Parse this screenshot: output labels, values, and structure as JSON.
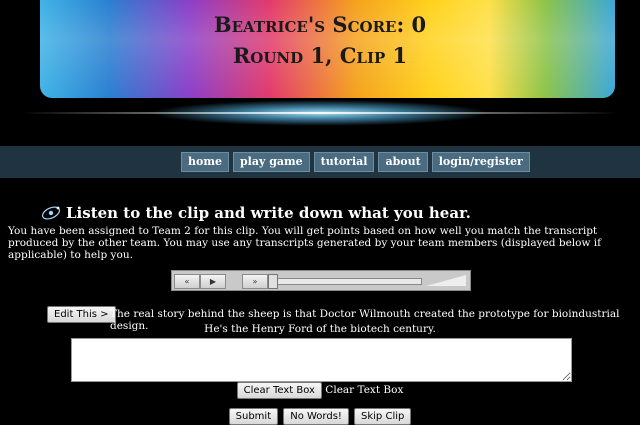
{
  "header": {
    "score_text": "Beatrice's Score: 0",
    "round_text": "Round 1, Clip 1"
  },
  "nav": {
    "items": [
      "home",
      "play game",
      "tutorial",
      "about",
      "login/register"
    ]
  },
  "instructions": {
    "heading": "Listen to the clip and write down what you hear.",
    "body": "You have been assigned to Team 2 for this clip. You will get points based on how well you match the transcript produced by the other team. You may use any transcripts generated by your team members (displayed below if applicable) to help you."
  },
  "player": {
    "rewind_label": "«",
    "play_label": "▶",
    "forward_label": "»"
  },
  "transcript": {
    "edit_label": "Edit This >",
    "line1": "The real story behind the sheep is that Doctor Wilmouth created the prototype for bioindustrial design.",
    "line2": "He's the Henry Ford of the biotech century."
  },
  "form": {
    "textbox_value": "",
    "clear_button_label": "Clear Text Box",
    "clear_text_label": "Clear Text Box",
    "submit_label": "Submit",
    "no_words_label": "No Words!",
    "skip_label": "Skip Clip"
  },
  "colors": {
    "navbar": "#1f3340",
    "nav_button": "#4a6b80"
  }
}
